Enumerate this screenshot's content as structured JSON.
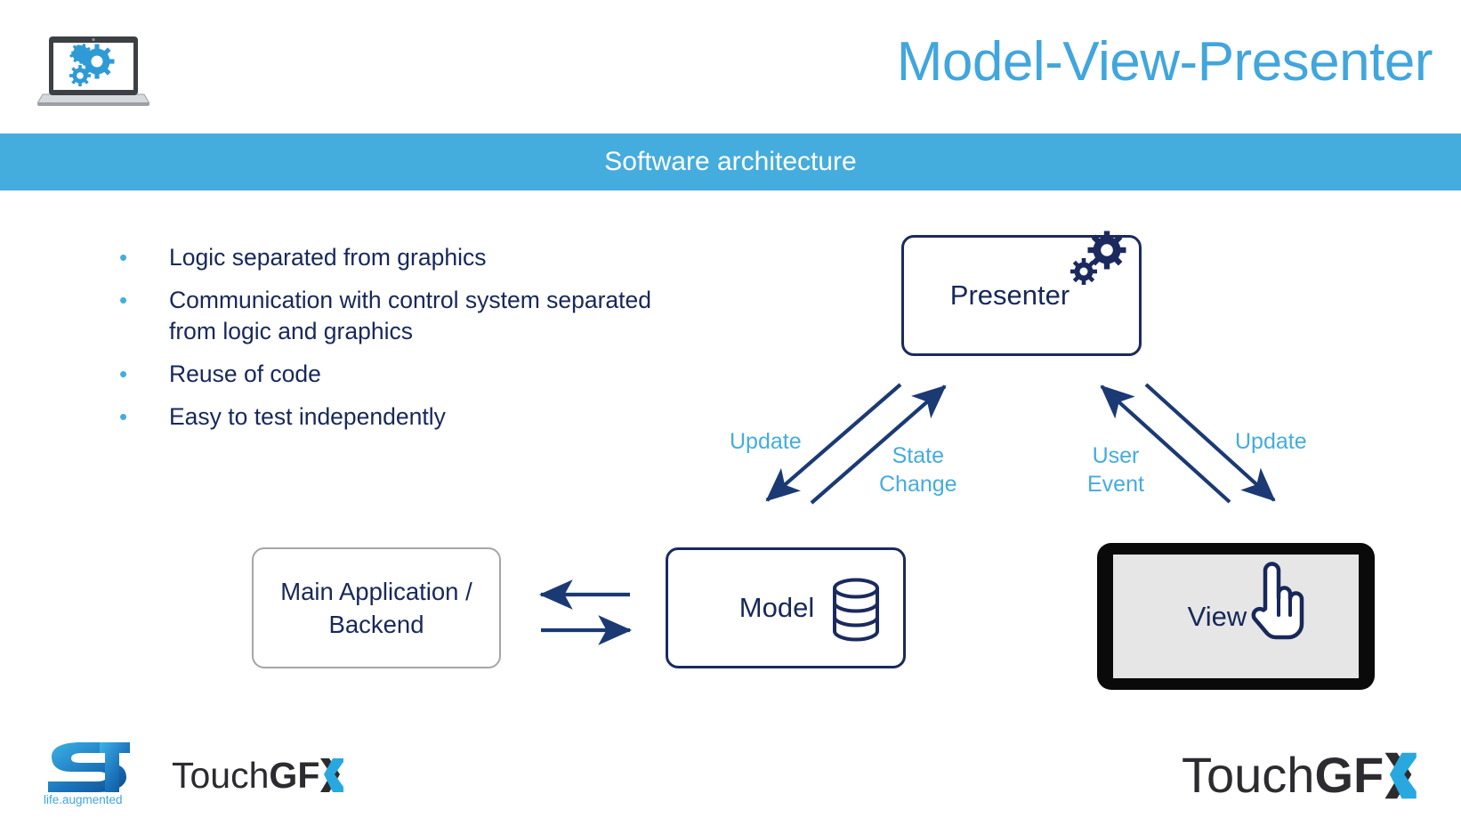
{
  "slide": {
    "title": "Model-View-Presenter",
    "subtitle": "Software architecture",
    "title_color": "#41A6DC",
    "subtitle_bar_color": "#45ACDE",
    "body_text_color": "#17285A"
  },
  "header": {
    "logo_icon": "laptop-gears-icon"
  },
  "bullets": [
    {
      "text": "Logic separated from graphics"
    },
    {
      "text": "Communication with control system separated from logic and graphics"
    },
    {
      "text": "Reuse of code"
    },
    {
      "text": "Easy to test independently"
    }
  ],
  "diagram": {
    "nodes": {
      "presenter": {
        "label": "Presenter",
        "icon": "gears-icon",
        "border_color": "#1B2A5E"
      },
      "model": {
        "label": "Model",
        "icon": "database-icon",
        "border_color": "#1B2A5E"
      },
      "view": {
        "label": "View",
        "icon": "pointing-hand-icon",
        "bezel_color": "#0a0a0a",
        "screen_color": "#E6E6E6"
      },
      "backend": {
        "line1": "Main Application /",
        "line2": "Backend",
        "border_color": "#A6A6A6"
      }
    },
    "arrow_labels": {
      "update_left": "Update",
      "state_change": "State\nChange",
      "user_event": "User\nEvent",
      "update_right": "Update"
    },
    "arrow_color": "#1B3A74",
    "label_color": "#45ACDE"
  },
  "footer": {
    "st_logo": {
      "wordmark": "ST",
      "tagline": "life.augmented",
      "tagline_color": "#41A6DC"
    },
    "touchgfx_left": {
      "part1": "Touch",
      "part2": "GF",
      "part3": "X"
    },
    "touchgfx_right": {
      "part1": "Touch",
      "part2": "GF",
      "part3": "X"
    },
    "touchgfx_accent_color": "#29A8E0"
  }
}
